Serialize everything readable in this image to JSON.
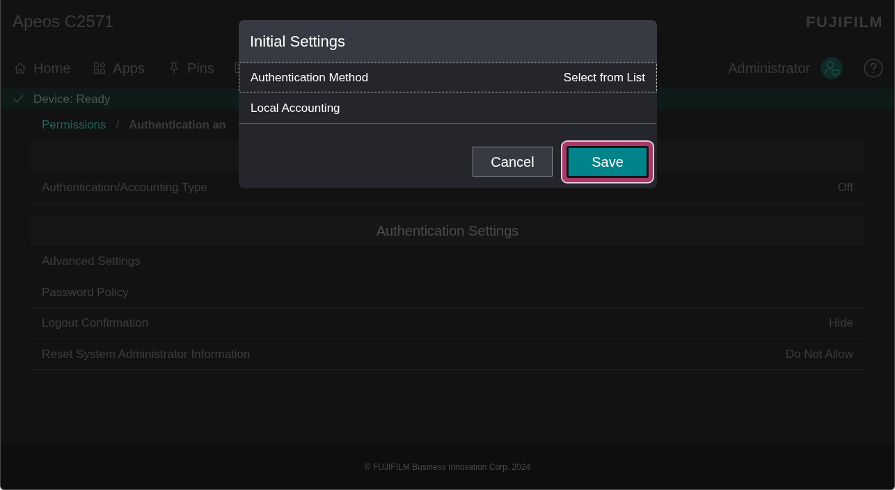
{
  "header": {
    "title": "Apeos C2571",
    "logo": "FUJIFILM"
  },
  "nav": [
    {
      "kind": "text",
      "label": "Home"
    },
    {
      "kind": "text",
      "label": "Apps"
    },
    {
      "kind": "text",
      "label": "Pins"
    },
    {
      "kind": "icon"
    }
  ],
  "user": {
    "label": "Administrator"
  },
  "status_bar": {
    "text": "Device: Ready"
  },
  "breadcrumb": {
    "separator": "/",
    "items": [
      {
        "kind": "link",
        "label": "Permissions"
      },
      {
        "kind": "current",
        "label": "Authentication an"
      }
    ]
  },
  "settings": [
    {
      "kind": "band"
    },
    {
      "kind": "row",
      "label": "Authentication/Accounting Type",
      "value": "Off"
    },
    {
      "kind": "band",
      "label": "Authentication Settings"
    },
    {
      "kind": "row",
      "label": "Advanced Settings"
    },
    {
      "kind": "row",
      "label": "Password Policy"
    },
    {
      "kind": "row",
      "label": "Logout Confirmation",
      "value": "Hide"
    },
    {
      "kind": "row",
      "label": "Reset System Administrator Information",
      "value": "Do Not Allow"
    }
  ],
  "footer": {
    "text": "© FUJIFILM Business Innovation Corp. 2024"
  },
  "dialog": {
    "title": "Initial Settings",
    "rows": [
      {
        "label": "Authentication Method",
        "value": "Select from List",
        "focused": true
      },
      {
        "label": "Local Accounting",
        "focused": false
      }
    ],
    "buttons": [
      {
        "kind": "secondary",
        "label": "Cancel",
        "focused": false
      },
      {
        "kind": "primary",
        "label": "Save",
        "focused": true
      }
    ]
  }
}
